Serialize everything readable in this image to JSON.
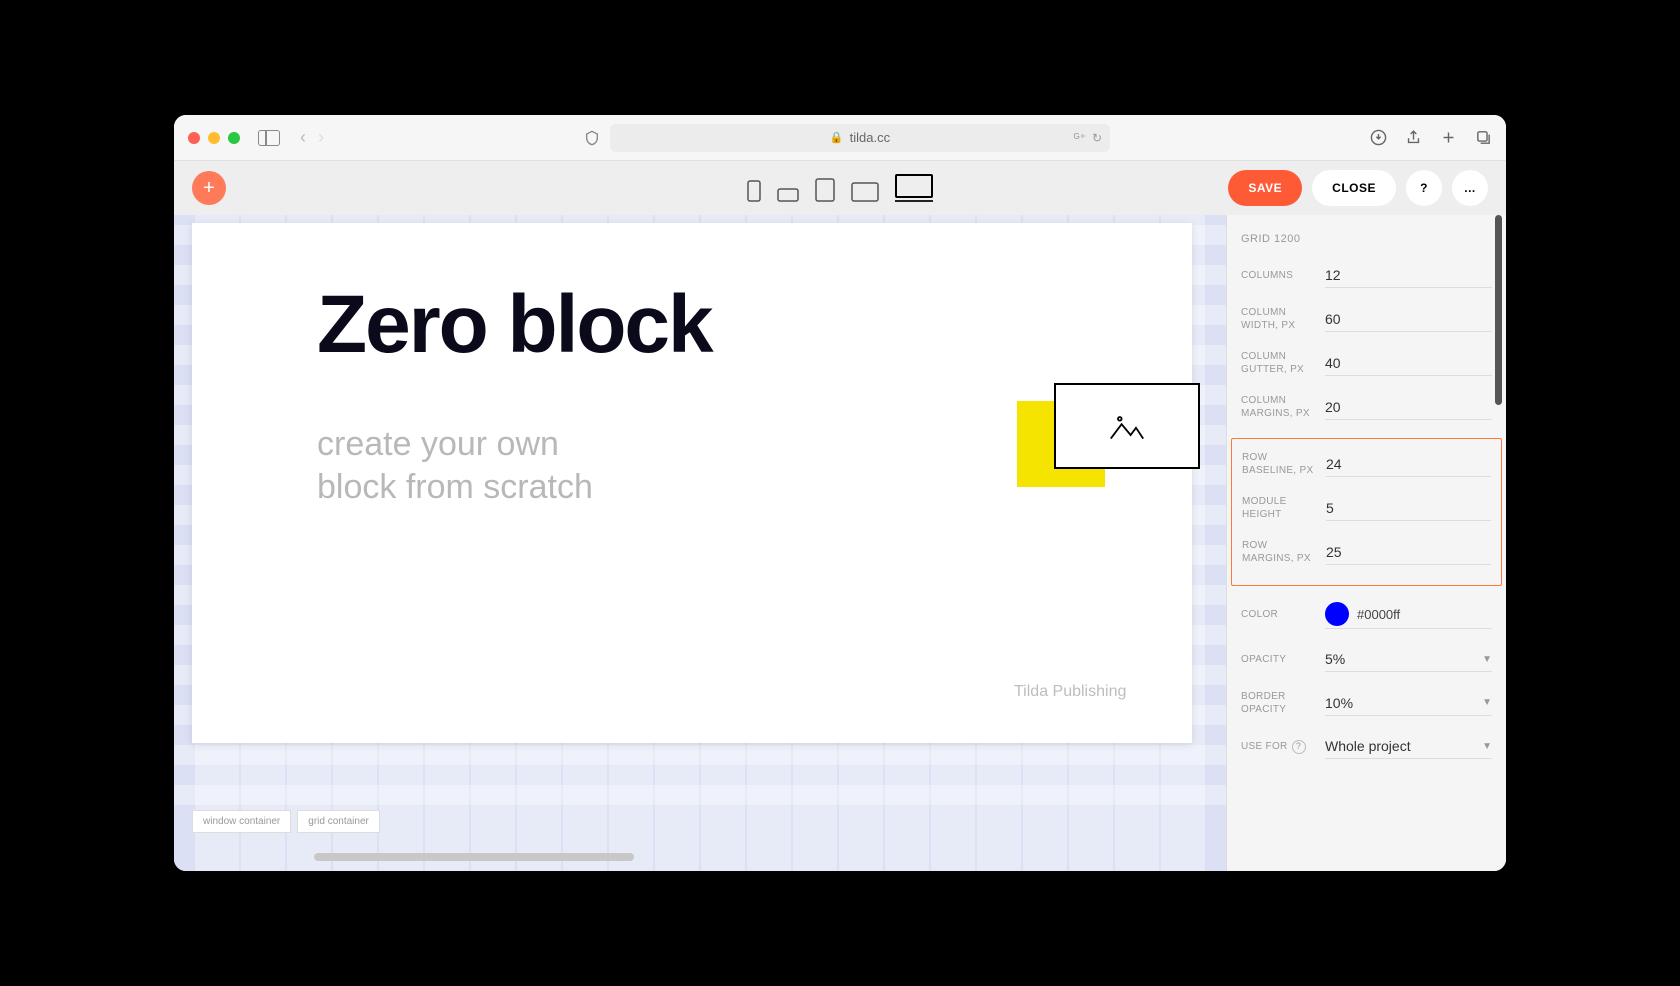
{
  "browser": {
    "url": "tilda.cc"
  },
  "toolbar": {
    "save_label": "SAVE",
    "close_label": "CLOSE",
    "more_label": "..."
  },
  "canvas": {
    "title": "Zero block",
    "subtitle_line1": "create your own",
    "subtitle_line2": "block from scratch",
    "publisher": "Tilda Publishing",
    "window_container_label": "window container",
    "grid_container_label": "grid container"
  },
  "panel": {
    "header": "GRID 1200",
    "columns_label": "COLUMNS",
    "columns_value": "12",
    "col_width_label": "COLUMN WIDTH, PX",
    "col_width_value": "60",
    "col_gutter_label": "COLUMN GUTTER, PX",
    "col_gutter_value": "40",
    "col_margins_label": "COLUMN MARGINS, PX",
    "col_margins_value": "20",
    "row_baseline_label": "ROW BASELINE, PX",
    "row_baseline_value": "24",
    "module_height_label": "MODULE HEIGHT",
    "module_height_value": "5",
    "row_margins_label": "ROW MARGINS, PX",
    "row_margins_value": "25",
    "color_label": "COLOR",
    "color_value": "#0000ff",
    "opacity_label": "OPACITY",
    "opacity_value": "5%",
    "border_opacity_label": "BORDER OPACITY",
    "border_opacity_value": "10%",
    "use_for_label": "USE FOR",
    "use_for_value": "Whole project"
  }
}
